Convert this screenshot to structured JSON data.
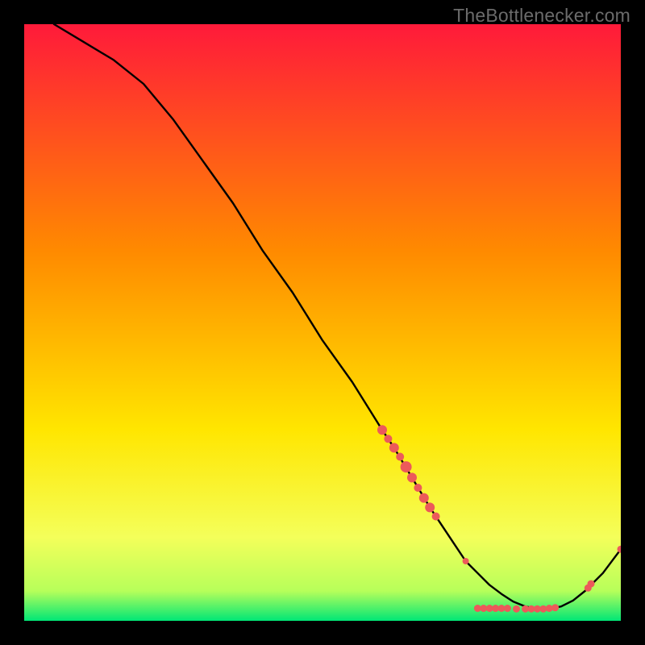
{
  "watermark": "TheBottlenecker.com",
  "colors": {
    "gradient_top": "#ff1a3a",
    "gradient_mid1": "#ff6a00",
    "gradient_mid2": "#ffe600",
    "gradient_low1": "#f4ff5a",
    "gradient_low2": "#b7ff5a",
    "gradient_bottom": "#00e676",
    "curve": "#000000",
    "marker": "#ec5a5a"
  },
  "chart_data": {
    "type": "line",
    "title": "",
    "xlabel": "",
    "ylabel": "",
    "xlim": [
      0,
      100
    ],
    "ylim": [
      0,
      100
    ],
    "series": [
      {
        "name": "curve",
        "x": [
          5,
          10,
          15,
          20,
          25,
          30,
          35,
          40,
          45,
          50,
          55,
          60,
          62,
          65,
          68,
          70,
          72,
          74,
          76,
          78,
          80,
          82,
          84,
          86,
          88,
          90,
          92,
          94,
          97,
          100
        ],
        "y": [
          100,
          97,
          94,
          90,
          84,
          77,
          70,
          62,
          55,
          47,
          40,
          32,
          29,
          24,
          19,
          16,
          13,
          10,
          8,
          6,
          4.5,
          3.2,
          2.4,
          2,
          2,
          2.4,
          3.4,
          5,
          8,
          12
        ]
      }
    ],
    "markers": [
      {
        "x": 60,
        "y": 32,
        "r": 6
      },
      {
        "x": 61,
        "y": 30.5,
        "r": 5
      },
      {
        "x": 62,
        "y": 29,
        "r": 6
      },
      {
        "x": 63,
        "y": 27.5,
        "r": 5
      },
      {
        "x": 64,
        "y": 25.8,
        "r": 7
      },
      {
        "x": 65,
        "y": 24,
        "r": 6
      },
      {
        "x": 66,
        "y": 22.3,
        "r": 5
      },
      {
        "x": 67,
        "y": 20.6,
        "r": 6
      },
      {
        "x": 68,
        "y": 19,
        "r": 6
      },
      {
        "x": 69,
        "y": 17.5,
        "r": 5
      },
      {
        "x": 74,
        "y": 10,
        "r": 4
      },
      {
        "x": 76,
        "y": 2.1,
        "r": 4.5
      },
      {
        "x": 77,
        "y": 2.1,
        "r": 4.5
      },
      {
        "x": 78,
        "y": 2.1,
        "r": 4.5
      },
      {
        "x": 79,
        "y": 2.1,
        "r": 4.5
      },
      {
        "x": 80,
        "y": 2.1,
        "r": 4.5
      },
      {
        "x": 81,
        "y": 2.1,
        "r": 4.5
      },
      {
        "x": 82.5,
        "y": 2.0,
        "r": 4.5
      },
      {
        "x": 84,
        "y": 2.0,
        "r": 4.5
      },
      {
        "x": 85,
        "y": 2.0,
        "r": 4.5
      },
      {
        "x": 86,
        "y": 2.0,
        "r": 4.5
      },
      {
        "x": 87,
        "y": 2.0,
        "r": 4.5
      },
      {
        "x": 88,
        "y": 2.1,
        "r": 4.5
      },
      {
        "x": 89,
        "y": 2.2,
        "r": 4.5
      },
      {
        "x": 94.5,
        "y": 5.5,
        "r": 4.5
      },
      {
        "x": 95,
        "y": 6.2,
        "r": 4.5
      },
      {
        "x": 100,
        "y": 12,
        "r": 4.5
      }
    ]
  }
}
